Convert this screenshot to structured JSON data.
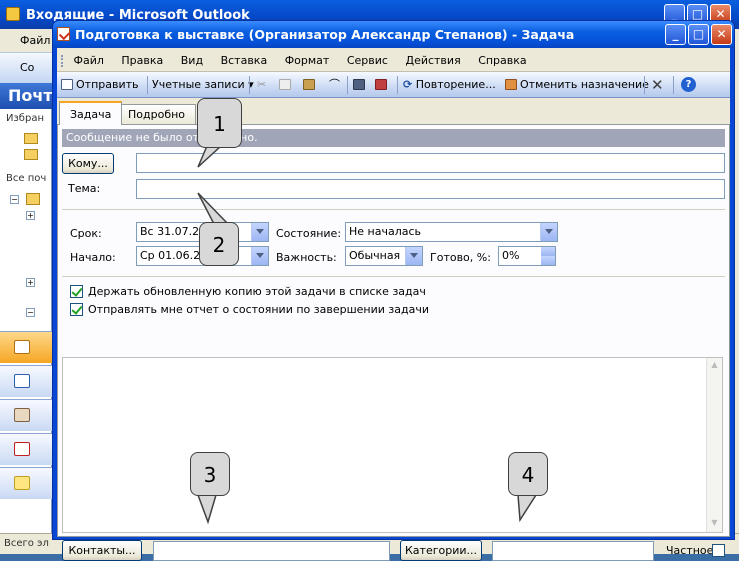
{
  "background_window": {
    "title": "Входящие - Microsoft Outlook",
    "menu_first": "Файл",
    "toolbar_first": "Со",
    "pane_header": "Почт",
    "pane_favorites": "Избран",
    "pane_all": "Все поч",
    "status": "Всего эл"
  },
  "window": {
    "title": "Подготовка к выставке (Организатор Александр Степанов) - Задача",
    "title_buttons": [
      "_",
      "□",
      "✕"
    ]
  },
  "menu": [
    "Файл",
    "Правка",
    "Вид",
    "Вставка",
    "Формат",
    "Сервис",
    "Действия",
    "Справка"
  ],
  "toolbar": {
    "send": "Отправить",
    "accounts": "Учетные записи",
    "recurrence": "Повторение...",
    "cancel_assignment": "Отменить назначение"
  },
  "tabs": [
    "Задача",
    "Подробно"
  ],
  "infobar": "Сообщение не было отправлено.",
  "form": {
    "to_button": "Кому...",
    "to_value": "",
    "subject_label": "Тема:",
    "subject_value": "",
    "due_label": "Срок:",
    "due_value": "Вс 31.07.20",
    "start_label": "Начало:",
    "start_value": "Ср 01.06.20",
    "status_label": "Состояние:",
    "status_value": "Не началась",
    "priority_label": "Важность:",
    "priority_value": "Обычная",
    "done_label": "Готово, %:",
    "done_value": "0%",
    "keep_copy_label": "Держать обновленную копию этой задачи в списке задач",
    "keep_copy_checked": true,
    "status_report_label": "Отправлять мне отчет о состоянии по завершении задачи",
    "status_report_checked": true,
    "contacts_button": "Контакты...",
    "contacts_value": "",
    "categories_button": "Категории...",
    "categories_value": "",
    "private_label": "Частное",
    "private_checked": false
  },
  "callouts": [
    "1",
    "2",
    "3",
    "4"
  ],
  "colors": {
    "title_blue": "#0a5fe0",
    "infobar": "#a0a6b8",
    "tab_accent": "#f5a623"
  }
}
